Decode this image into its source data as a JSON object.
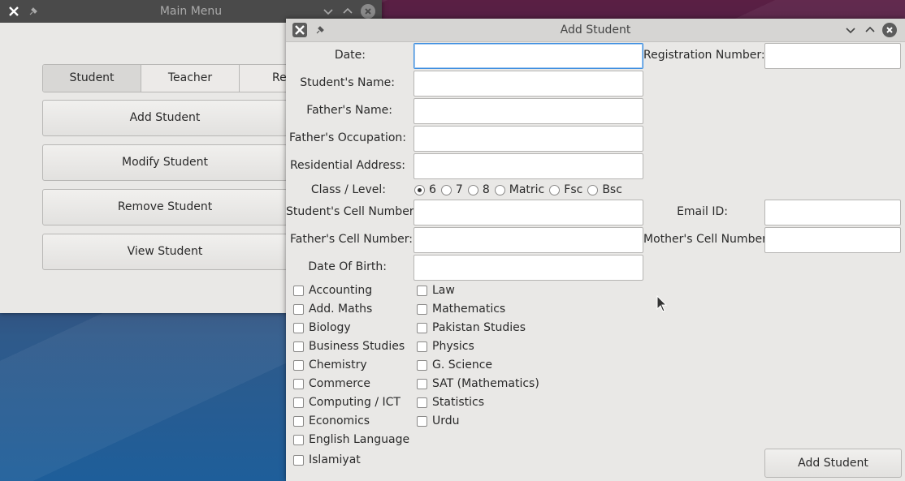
{
  "main_window": {
    "title": "Main Menu",
    "tabs": [
      {
        "label": "Student"
      },
      {
        "label": "Teacher"
      },
      {
        "label": "Re"
      }
    ],
    "buttons": [
      {
        "label": "Add Student"
      },
      {
        "label": "Modify Student"
      },
      {
        "label": "Remove Student"
      },
      {
        "label": "View Student"
      }
    ]
  },
  "add_window": {
    "title": "Add Student",
    "labels": {
      "date": "Date:",
      "registration_number": "Registration Number:",
      "students_name": "Student's Name:",
      "fathers_name": "Father's Name:",
      "fathers_occupation": "Father's Occupation:",
      "residential_address": "Residential Address:",
      "class_level": "Class / Level:",
      "students_cell": "Student's Cell Number:",
      "email_id": "Email ID:",
      "fathers_cell": "Father's Cell Number:",
      "mothers_cell": "Mother's Cell Number:",
      "date_of_birth": "Date Of Birth:"
    },
    "values": {
      "date": "",
      "registration_number": "",
      "students_name": "",
      "fathers_name": "",
      "fathers_occupation": "",
      "residential_address": "",
      "students_cell": "",
      "email_id": "",
      "fathers_cell": "",
      "mothers_cell": "",
      "date_of_birth": ""
    },
    "class_options": [
      {
        "label": "6",
        "selected": true
      },
      {
        "label": "7",
        "selected": false
      },
      {
        "label": "8",
        "selected": false
      },
      {
        "label": "Matric",
        "selected": false
      },
      {
        "label": "Fsc",
        "selected": false
      },
      {
        "label": "Bsc",
        "selected": false
      }
    ],
    "subjects_left": [
      "Accounting",
      "Add. Maths",
      "Biology",
      "Business Studies",
      "Chemistry",
      "Commerce",
      "Computing / ICT",
      "Economics",
      "English Language",
      "Islamiyat"
    ],
    "subjects_right": [
      "Law",
      "Mathematics",
      "Pakistan Studies",
      "Physics",
      "G. Science",
      "SAT (Mathematics)",
      "Statistics",
      "Urdu"
    ],
    "submit_label": "Add Student"
  }
}
